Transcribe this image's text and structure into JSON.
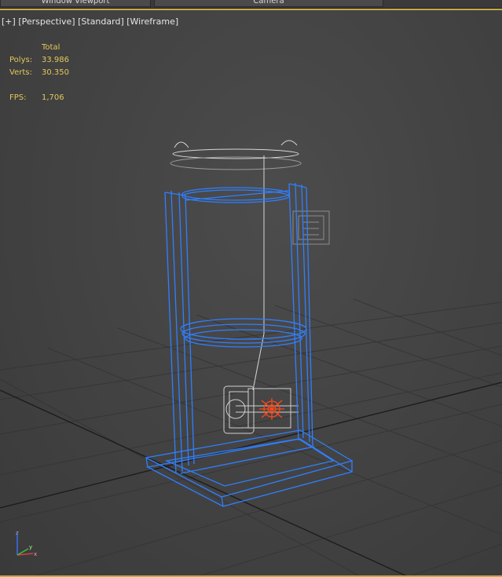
{
  "tabs": [
    "Window Viewport",
    "Camera"
  ],
  "viewport": {
    "label_plus": "[+]",
    "label_view": "[Perspective]",
    "label_shading": "[Standard]",
    "label_mode": "[Wireframe]"
  },
  "stats": {
    "header": "Total",
    "polys_label": "Polys:",
    "polys_value": "33.986",
    "verts_label": "Verts:",
    "verts_value": "30.350",
    "fps_label": "FPS:",
    "fps_value": "1,706"
  },
  "axis": {
    "z": "z",
    "x": "x",
    "y": "y"
  },
  "colors": {
    "selected_wire": "#2f7fff",
    "unselected_wire": "#d6d6d6",
    "highlight": "#ff4a1a",
    "grid": "#2e2e2e",
    "text_yellow": "#e3c85a"
  }
}
